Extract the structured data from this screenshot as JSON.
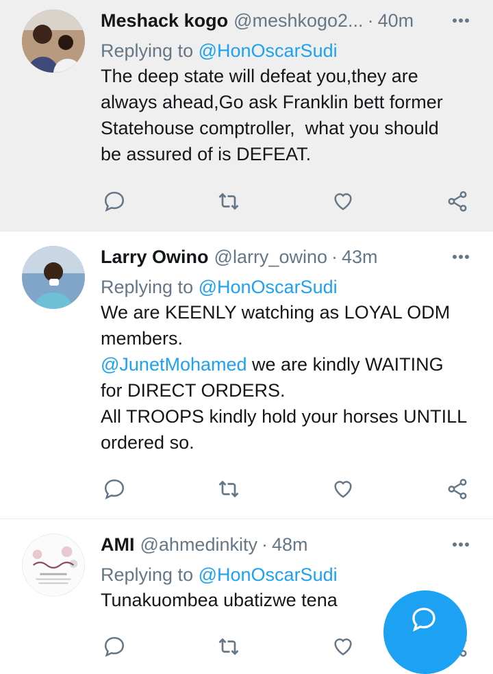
{
  "colors": {
    "accent": "#1da1f2",
    "muted": "#657786",
    "text": "#14171a",
    "highlight_bg": "#efefef"
  },
  "tweets": [
    {
      "name": "Meshack kogo",
      "handle": "@meshkogo2...",
      "separator": "·",
      "time": "40m",
      "reply_prefix": "Replying to",
      "reply_to": "@HonOscarSudi",
      "lines": [
        "The deep state will defeat you,they are",
        "always ahead,Go ask Franklin bett former",
        "Statehouse comptroller,  what you should",
        "be assured of is DEFEAT."
      ],
      "icons": {
        "reply": "reply-icon",
        "retweet": "retweet-icon",
        "like": "heart-icon",
        "share": "share-icon",
        "more": "more-icon"
      }
    },
    {
      "name": "Larry Owino",
      "handle": "@larry_owino",
      "separator": "·",
      "time": "43m",
      "reply_prefix": "Replying to",
      "reply_to": "@HonOscarSudi",
      "lines": [
        "We are KEENLY watching as LOYAL ODM",
        "members."
      ],
      "mention_line": {
        "mention": "@JunetMohamed",
        "rest": " we are kindly WAITING"
      },
      "lines_after": [
        "for DIRECT ORDERS.",
        "All TROOPS kindly hold your horses UNTILL",
        "ordered so."
      ]
    },
    {
      "name": "AMI",
      "handle": "@ahmedinkity",
      "separator": "·",
      "time": "48m",
      "reply_prefix": "Replying to",
      "reply_to": "@HonOscarSudi",
      "lines": [
        "Tunakuombea ubatizwe tena"
      ]
    }
  ],
  "fab": {
    "icon": "compose-reply-icon"
  }
}
